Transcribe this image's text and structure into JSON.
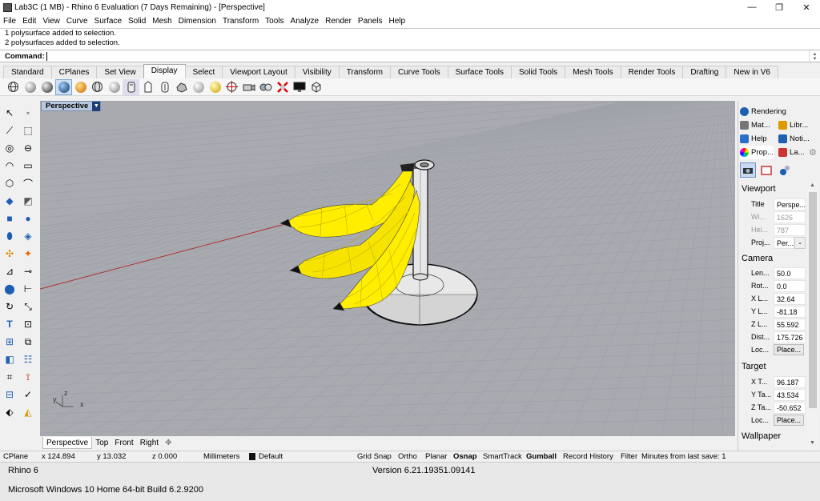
{
  "window": {
    "title": "Lab3C (1 MB) - Rhino 6 Evaluation (7 Days Remaining) - [Perspective]",
    "minimize": "—",
    "maximize": "❐",
    "close": "✕"
  },
  "menu": [
    "File",
    "Edit",
    "View",
    "Curve",
    "Surface",
    "Solid",
    "Mesh",
    "Dimension",
    "Transform",
    "Tools",
    "Analyze",
    "Render",
    "Panels",
    "Help"
  ],
  "history": [
    "1 polysurface added to selection.",
    "2 polysurfaces added to selection."
  ],
  "command": {
    "label": "Command:",
    "value": ""
  },
  "toolbar_tabs": [
    "Standard",
    "CPlanes",
    "Set View",
    "Display",
    "Select",
    "Viewport Layout",
    "Visibility",
    "Transform",
    "Curve Tools",
    "Surface Tools",
    "Solid Tools",
    "Mesh Tools",
    "Render Tools",
    "Drafting",
    "New in V6"
  ],
  "active_tab": "Display",
  "display_icons": [
    "wireframe-icon",
    "shaded-icon",
    "rendered-icon",
    "ghosted-icon",
    "xray-icon",
    "technical-icon",
    "artistic-icon",
    "pen-icon",
    "arctic-icon",
    "raytraced-icon",
    "shaded-sphere-icon",
    "gold-sphere-icon",
    "sun-icon",
    "target-icon",
    "camera-icon",
    "light-icon",
    "render-cancel-icon",
    "monitor-icon",
    "cube-icon"
  ],
  "viewport": {
    "label": "Perspective",
    "dropdown": "▼",
    "axis_y": "y",
    "axis_z": "z",
    "axis_x": "x"
  },
  "viewport_tabs": [
    "Perspective",
    "Top",
    "Front",
    "Right"
  ],
  "viewport_tab_add": "✥",
  "status": {
    "cplane": "CPlane",
    "x": "x 124.894",
    "y": "y 13.032",
    "z": "z 0.000",
    "units": "Millimeters",
    "layer": "Default",
    "toggles": [
      "Grid Snap",
      "Ortho",
      "Planar",
      "Osnap",
      "SmartTrack",
      "Gumball",
      "Record History",
      "Filter"
    ],
    "bold_toggles": [
      "Osnap",
      "Gumball"
    ],
    "save_info": "Minutes from last save: 1"
  },
  "panels": {
    "tabs_row1": [
      "Rendering"
    ],
    "tabs_row2": [
      "Mat...",
      "Libr..."
    ],
    "tabs_row3": [
      "Help",
      "Noti..."
    ],
    "tabs_row4": [
      "Prop...",
      "La..."
    ],
    "sections": {
      "viewport": "Viewport",
      "camera": "Camera",
      "target": "Target",
      "wallpaper": "Wallpaper"
    },
    "viewport_props": [
      {
        "k": "Title",
        "v": "Perspe..."
      },
      {
        "k": "Wi...",
        "v": "1626"
      },
      {
        "k": "Hei...",
        "v": "787"
      },
      {
        "k": "Proj...",
        "v": "Per..."
      }
    ],
    "camera_props": [
      {
        "k": "Len...",
        "v": "50.0"
      },
      {
        "k": "Rot...",
        "v": "0.0"
      },
      {
        "k": "X L...",
        "v": "32.64"
      },
      {
        "k": "Y L...",
        "v": "-81.18"
      },
      {
        "k": "Z L...",
        "v": "55.592"
      },
      {
        "k": "Dist...",
        "v": "175.726"
      },
      {
        "k": "Loc...",
        "v": "Place..."
      }
    ],
    "target_props": [
      {
        "k": "X T...",
        "v": "96.187"
      },
      {
        "k": "Y Ta...",
        "v": "43.534"
      },
      {
        "k": "Z Ta...",
        "v": "-50.652"
      },
      {
        "k": "Loc...",
        "v": "Place..."
      }
    ]
  },
  "footer": {
    "app": "Rhino 6",
    "version": "Version 6.21.19351.09141",
    "os": "Microsoft Windows 10 Home 64-bit Build 6.2.9200"
  },
  "colors": {
    "viewport_bg": "#a8aab0",
    "grid": "#9ea1a7",
    "banana": "#ffee00",
    "x_axis": "#b03030",
    "active_tab": "#1e3f7a"
  }
}
